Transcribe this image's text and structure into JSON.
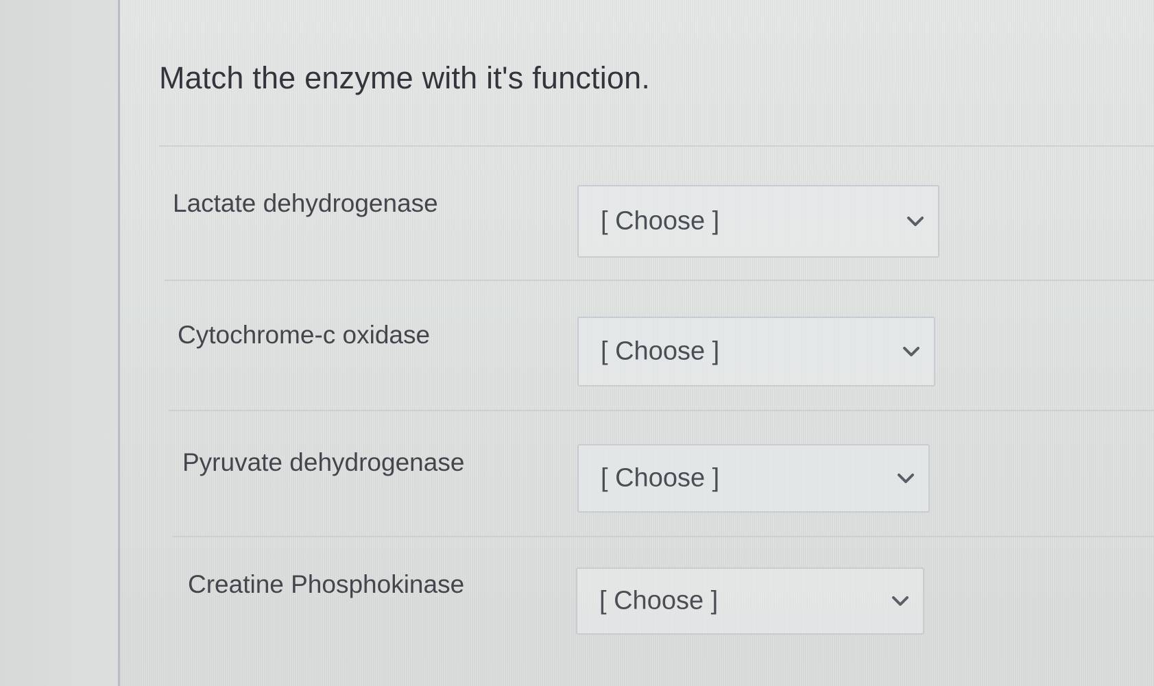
{
  "question": {
    "title": "Match the enzyme with it's function."
  },
  "rows": [
    {
      "label": "Lactate dehydrogenase",
      "select": {
        "selected": "[ Choose ]"
      }
    },
    {
      "label": "Cytochrome-c oxidase",
      "select": {
        "selected": "[ Choose ]"
      }
    },
    {
      "label": "Pyruvate dehydrogenase",
      "select": {
        "selected": "[ Choose ]"
      }
    },
    {
      "label": "Creatine Phosphokinase",
      "select": {
        "selected": "[ Choose ]"
      }
    }
  ],
  "icons": {
    "dropdown": "chevron-down-icon"
  },
  "colors": {
    "text": "#3b3e44",
    "border": "#c7ccd2",
    "background": "#e2e5e4"
  }
}
